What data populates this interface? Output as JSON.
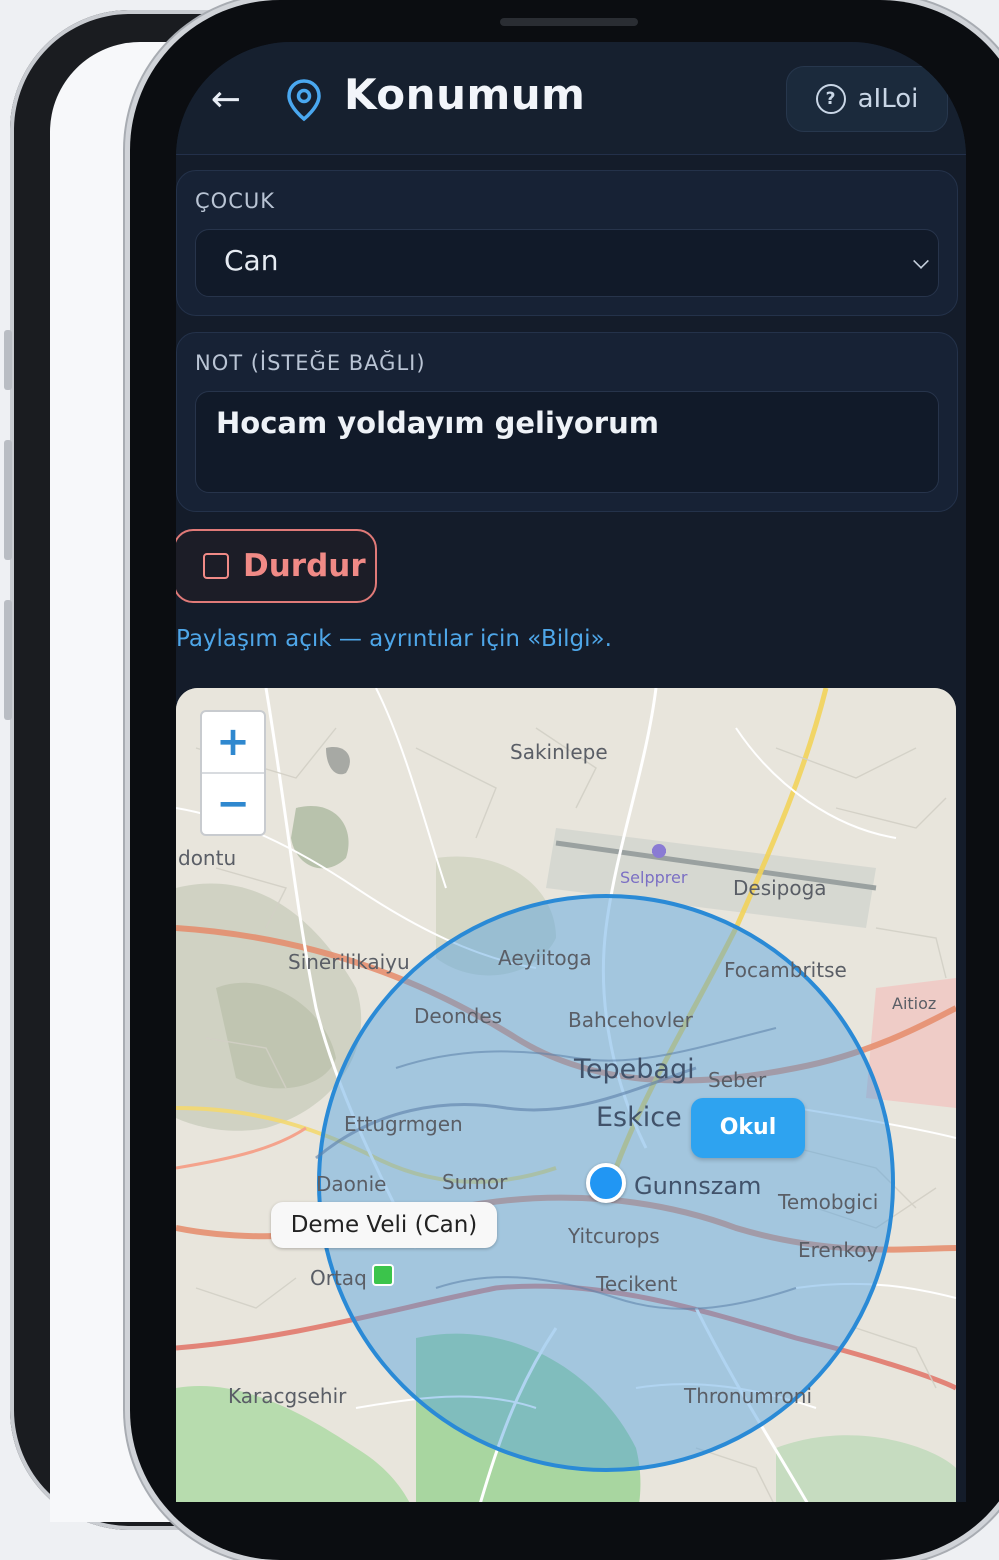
{
  "header": {
    "title": "Konumum",
    "info_label": "aILoi",
    "info_icon": "?"
  },
  "child_card": {
    "label": "ÇOCUK",
    "selected": "Can"
  },
  "note_card": {
    "label": "NOT (İSTEĞE BAĞLI)",
    "value": "Hocam yoldayım geliyorum"
  },
  "stop_button": {
    "label": "Durdur"
  },
  "status": {
    "text": "Paylaşım açık — ayrıntılar için «Bilgi»."
  },
  "map": {
    "zoom_in": "+",
    "zoom_out": "−",
    "school_label": "Okul",
    "parent_label": "Deme Veli (Can)",
    "places": [
      "Sakinlepe",
      "Desipoga",
      "Selpprer",
      "Sinerilikaiyu",
      "Aeyiitoga",
      "Focambritse",
      "Deondes",
      "Bahcehovler",
      "Tepebagi",
      "Seber",
      "Ettugrmgen",
      "Eskice",
      "Sumor",
      "Gunnszam",
      "Temobgici",
      "Daonie",
      "Yitcurops",
      "Erenkoy",
      "Ortaq",
      "Tecikent",
      "Karacgsehir",
      "Thronumroni",
      "dontu",
      "Aitioz"
    ],
    "colors": {
      "radius_fill": "#4f9fdf",
      "radius_stroke": "#2a8ad6",
      "self_marker": "#2196f3",
      "parent_marker": "#3bc44b"
    }
  }
}
